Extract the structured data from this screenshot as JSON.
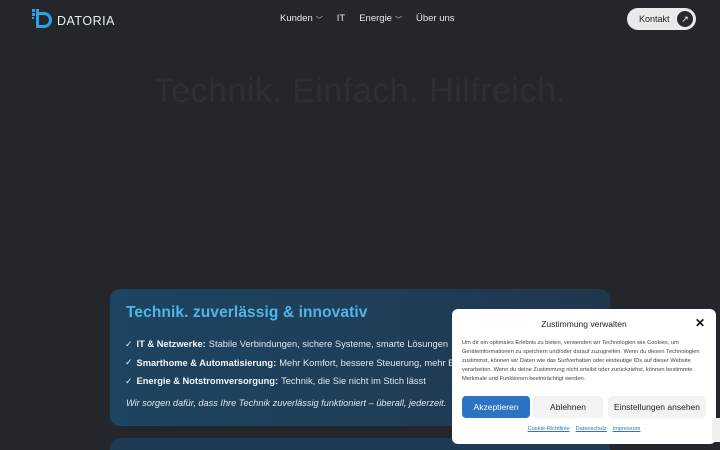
{
  "header": {
    "logo_text": "DATORIA",
    "nav": [
      {
        "label": "Kunden",
        "has_dropdown": true
      },
      {
        "label": "IT",
        "has_dropdown": false
      },
      {
        "label": "Energie",
        "has_dropdown": true
      },
      {
        "label": "Über uns",
        "has_dropdown": false
      }
    ],
    "contact_label": "Kontakt",
    "contact_icon": "arrow-up-right-icon"
  },
  "hero": {
    "headline": "Technik. Einfach. Hilfreich."
  },
  "card": {
    "title": "Technik. zuverlässig & innovativ",
    "items": [
      {
        "bold": "IT & Netzwerke:",
        "text": "Stabile Verbindungen, sichere Systeme, smarte Lösungen"
      },
      {
        "bold": "Smarthome & Automatisierung:",
        "text": "Mehr Komfort, bessere Steuerung, mehr Effizi"
      },
      {
        "bold": "Energie & Notstromversorgung:",
        "text": "Technik, die Sie nicht im Stich lässt"
      }
    ],
    "check_glyph": "✓",
    "quote": "Wir sorgen dafür, dass Ihre Technik zuverlässig funktioniert – überall, jederzeit."
  },
  "consent": {
    "title": "Zustimmung verwalten",
    "close_glyph": "✕",
    "text": "Um dir ein optimales Erlebnis zu bieten, verwenden wir Technologien wie Cookies, um Geräteinformationen zu speichern und/oder darauf zuzugreifen. Wenn du diesen Technologien zustimmst, können wir Daten wie das Surfverhalten oder eindeutige IDs auf dieser Website verarbeiten. Wenn du deine Zustimmung nicht erteilst oder zurückziehst, können bestimmte Merkmale und Funktionen beeinträchtigt werden.",
    "accept_label": "Akzeptieren",
    "deny_label": "Ablehnen",
    "settings_label": "Einstellungen ansehen",
    "links": [
      "Cookie-Richtlinie",
      "Datenschutz",
      "Impressum"
    ]
  },
  "colors": {
    "background": "#23262b",
    "accent": "#2ea3e0",
    "card_title": "#4fb6ea",
    "accept_button": "#2c73c4"
  }
}
